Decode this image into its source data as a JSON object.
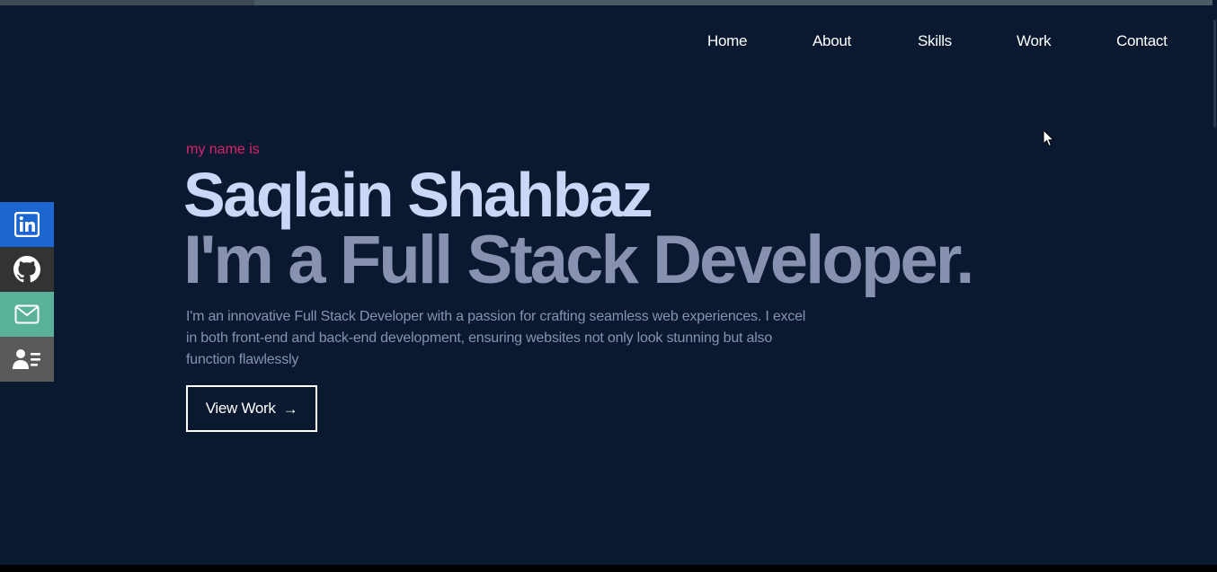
{
  "nav": {
    "items": [
      {
        "label": "Home"
      },
      {
        "label": "About"
      },
      {
        "label": "Skills"
      },
      {
        "label": "Work"
      },
      {
        "label": "Contact"
      }
    ]
  },
  "hero": {
    "kicker": "my name is",
    "name": "Saqlain Shahbaz",
    "title": "I'm a Full Stack Developer.",
    "description": "I'm an innovative Full Stack Developer with a passion for crafting seamless web experiences. I excel in both front-end and back-end development, ensuring websites not only look stunning but also function flawlessly",
    "cta_label": "View Work",
    "cta_arrow": "→"
  },
  "social": {
    "items": [
      {
        "icon": "linkedin-icon",
        "color": "#1b66d1"
      },
      {
        "icon": "github-icon",
        "color": "#333333"
      },
      {
        "icon": "mail-icon",
        "color": "#5ab29b"
      },
      {
        "icon": "resume-icon",
        "color": "#5a5a5a"
      }
    ]
  },
  "colors": {
    "background": "#0a1930",
    "accent": "#d6246b",
    "name": "#ccd6f6",
    "muted": "#8892b0",
    "white": "#ffffff"
  }
}
